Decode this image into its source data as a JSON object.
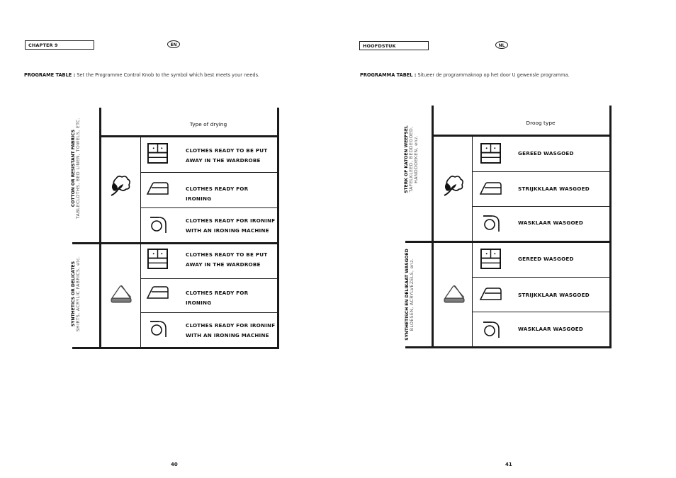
{
  "left_page": {
    "chapter_label": "CHAPTER 9",
    "language_badge": "EN",
    "intro_bold": "PROGRAME TABLE :",
    "intro_text": " Set the Programme Control Knob to the symbol which best meets your needs.",
    "table": {
      "header": "Type of drying",
      "sections": [
        {
          "fabric_title": "COTTON OR RESISTANT FABRICS",
          "fabric_subtitle": "TABLECLOTHS, BED LINEN, TOWELS, ETC.",
          "fabric_icon": "cotton-flower-icon",
          "rows": [
            {
              "icon": "wardrobe-icon",
              "line1": "CLOTHES READY TO BE PUT",
              "line2": "AWAY IN THE WARDROBE"
            },
            {
              "icon": "iron-icon",
              "line1": "CLOTHES READY FOR",
              "line2": "IRONING"
            },
            {
              "icon": "ironing-machine-icon",
              "line1": "CLOTHES READY FOR IRONINF",
              "line2": "WITH AN IRONING MACHINE"
            }
          ]
        },
        {
          "fabric_title": "SYNTHETICS OR DELICATES",
          "fabric_subtitle": "SHIRTS, ACRYLIC FABRICS, etc.",
          "fabric_icon": "synthetic-triangle-icon",
          "rows": [
            {
              "icon": "wardrobe-icon",
              "line1": "CLOTHES READY TO BE PUT",
              "line2": "AWAY IN THE WARDROBE"
            },
            {
              "icon": "iron-icon",
              "line1": "CLOTHES READY FOR",
              "line2": "IRONING"
            },
            {
              "icon": "ironing-machine-icon",
              "line1": "CLOTHES READY FOR IRONINF",
              "line2": "WITH AN IRONING MACHINE"
            }
          ]
        }
      ]
    },
    "page_number": "40"
  },
  "right_page": {
    "chapter_label": "HOOFDSTUK",
    "language_badge": "NL",
    "intro_bold": "PROGRAMMA TABEL :",
    "intro_text": " Situeer de programmaknop op het door U gewensle programma.",
    "table": {
      "header": "Droog type",
      "sections": [
        {
          "fabric_title": "STERK OF KATOEN WEEFSEL",
          "fabric_subtitle_1": "TAFELKLEED, BEDDEGOED,",
          "fabric_subtitle_2": "HANDDOEKEN, enz.",
          "fabric_icon": "cotton-flower-icon",
          "rows": [
            {
              "icon": "wardrobe-icon",
              "line1": "GEREED WASGOED"
            },
            {
              "icon": "iron-icon",
              "line1": "STRIJKKLAAR WASGOED"
            },
            {
              "icon": "ironing-machine-icon",
              "line1": "WASKLAAR WASGOED"
            }
          ]
        },
        {
          "fabric_title": "SYNTHETISCH EN DELIKAAT WASGOED",
          "fabric_subtitle_1": "BLOESEN, ACRYLVEZELS, enz.",
          "fabric_icon": "synthetic-triangle-icon",
          "rows": [
            {
              "icon": "wardrobe-icon",
              "line1": "GEREED WASGOED"
            },
            {
              "icon": "iron-icon",
              "line1": "STRIJKKLAAR WASGOED"
            },
            {
              "icon": "ironing-machine-icon",
              "line1": "WASKLAAR WASGOED"
            }
          ]
        }
      ]
    },
    "page_number": "41"
  }
}
